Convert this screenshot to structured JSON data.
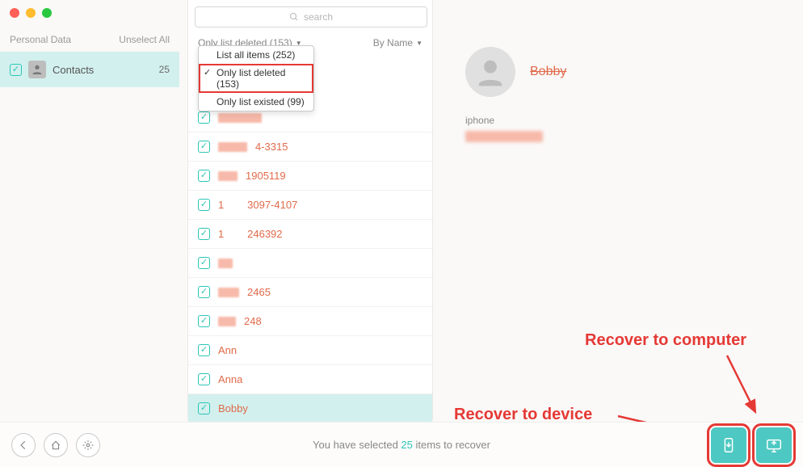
{
  "colors": {
    "accent": "#2cc6b7",
    "deleted": "#e06a4a",
    "anno": "#e53935"
  },
  "traffic": {
    "close": "#ff5f57",
    "min": "#febc2e",
    "max": "#28c840"
  },
  "sidebar": {
    "section_label": "Personal Data",
    "unselect_label": "Unselect All",
    "items": [
      {
        "label": "Contacts",
        "count": "25",
        "checked": true
      }
    ]
  },
  "search": {
    "placeholder": "search"
  },
  "toolbar": {
    "filter_label": "Only list deleted (153)",
    "sort_label": "By Name"
  },
  "dropdown": {
    "items": [
      {
        "label": "List all items (252)",
        "selected": false,
        "highlight": false
      },
      {
        "label": "Only list deleted (153)",
        "selected": true,
        "highlight": true
      },
      {
        "label": "Only list existed (99)",
        "selected": false,
        "highlight": false
      }
    ]
  },
  "contacts": [
    {
      "prefix_blur": 54,
      "suffix": "",
      "selected": false,
      "under_dropdown": true
    },
    {
      "prefix_blur": 36,
      "suffix": "4-3315",
      "selected": false
    },
    {
      "prefix_blur": 24,
      "suffix": "1905119",
      "selected": false
    },
    {
      "prefix_blur": 0,
      "suffix": "1        3097-4107",
      "selected": false
    },
    {
      "prefix_blur": 0,
      "suffix": "1        246392",
      "selected": false
    },
    {
      "prefix_blur": 18,
      "suffix": "",
      "selected": false
    },
    {
      "prefix_blur": 26,
      "suffix": "2465",
      "selected": false
    },
    {
      "prefix_blur": 22,
      "suffix": "248",
      "selected": false
    },
    {
      "prefix_blur": 0,
      "suffix": "Ann",
      "selected": false
    },
    {
      "prefix_blur": 0,
      "suffix": "Anna",
      "selected": false
    },
    {
      "prefix_blur": 0,
      "suffix": "Bobby",
      "selected": true
    },
    {
      "prefix_blur": 0,
      "suffix": "",
      "selected": false
    }
  ],
  "detail": {
    "name": "Bobby",
    "sub_label": "iphone"
  },
  "footer": {
    "text_pre": "You have selected ",
    "count": "25",
    "text_post": " items to recover"
  },
  "annotations": {
    "to_computer": "Recover to computer",
    "to_device": "Recover to device"
  }
}
